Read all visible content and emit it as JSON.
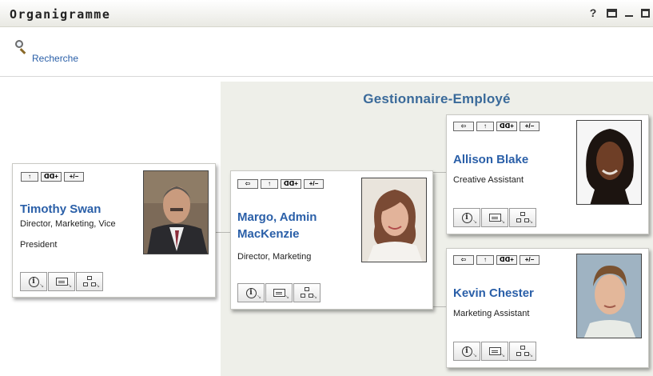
{
  "window": {
    "title": "Organigramme",
    "icons": [
      "help-icon",
      "print-icon",
      "minimize-icon",
      "maximize-icon"
    ],
    "help_glyph": "?"
  },
  "toolbar": {
    "search_label": "Recherche"
  },
  "org": {
    "title": "Gestionnaire-Employé",
    "colors": {
      "accent": "#2a5fa8",
      "panel": "#eeefe9",
      "title": "#3a6a9a"
    }
  },
  "card_buttons": {
    "up": "↑",
    "expand": "ᗡᗡ+",
    "toggle": "+/−",
    "back": "⇦"
  },
  "people": {
    "timothy": {
      "name": "Timothy Swan",
      "title_line1": "Director, Marketing, Vice",
      "title_line2": "President"
    },
    "margo": {
      "name_line1": "Margo, Admin",
      "name_line2": "MacKenzie",
      "title": "Director, Marketing"
    },
    "allison": {
      "name": "Allison Blake",
      "title": "Creative Assistant"
    },
    "kevin": {
      "name": "Kevin Chester",
      "title": "Marketing Assistant"
    }
  }
}
